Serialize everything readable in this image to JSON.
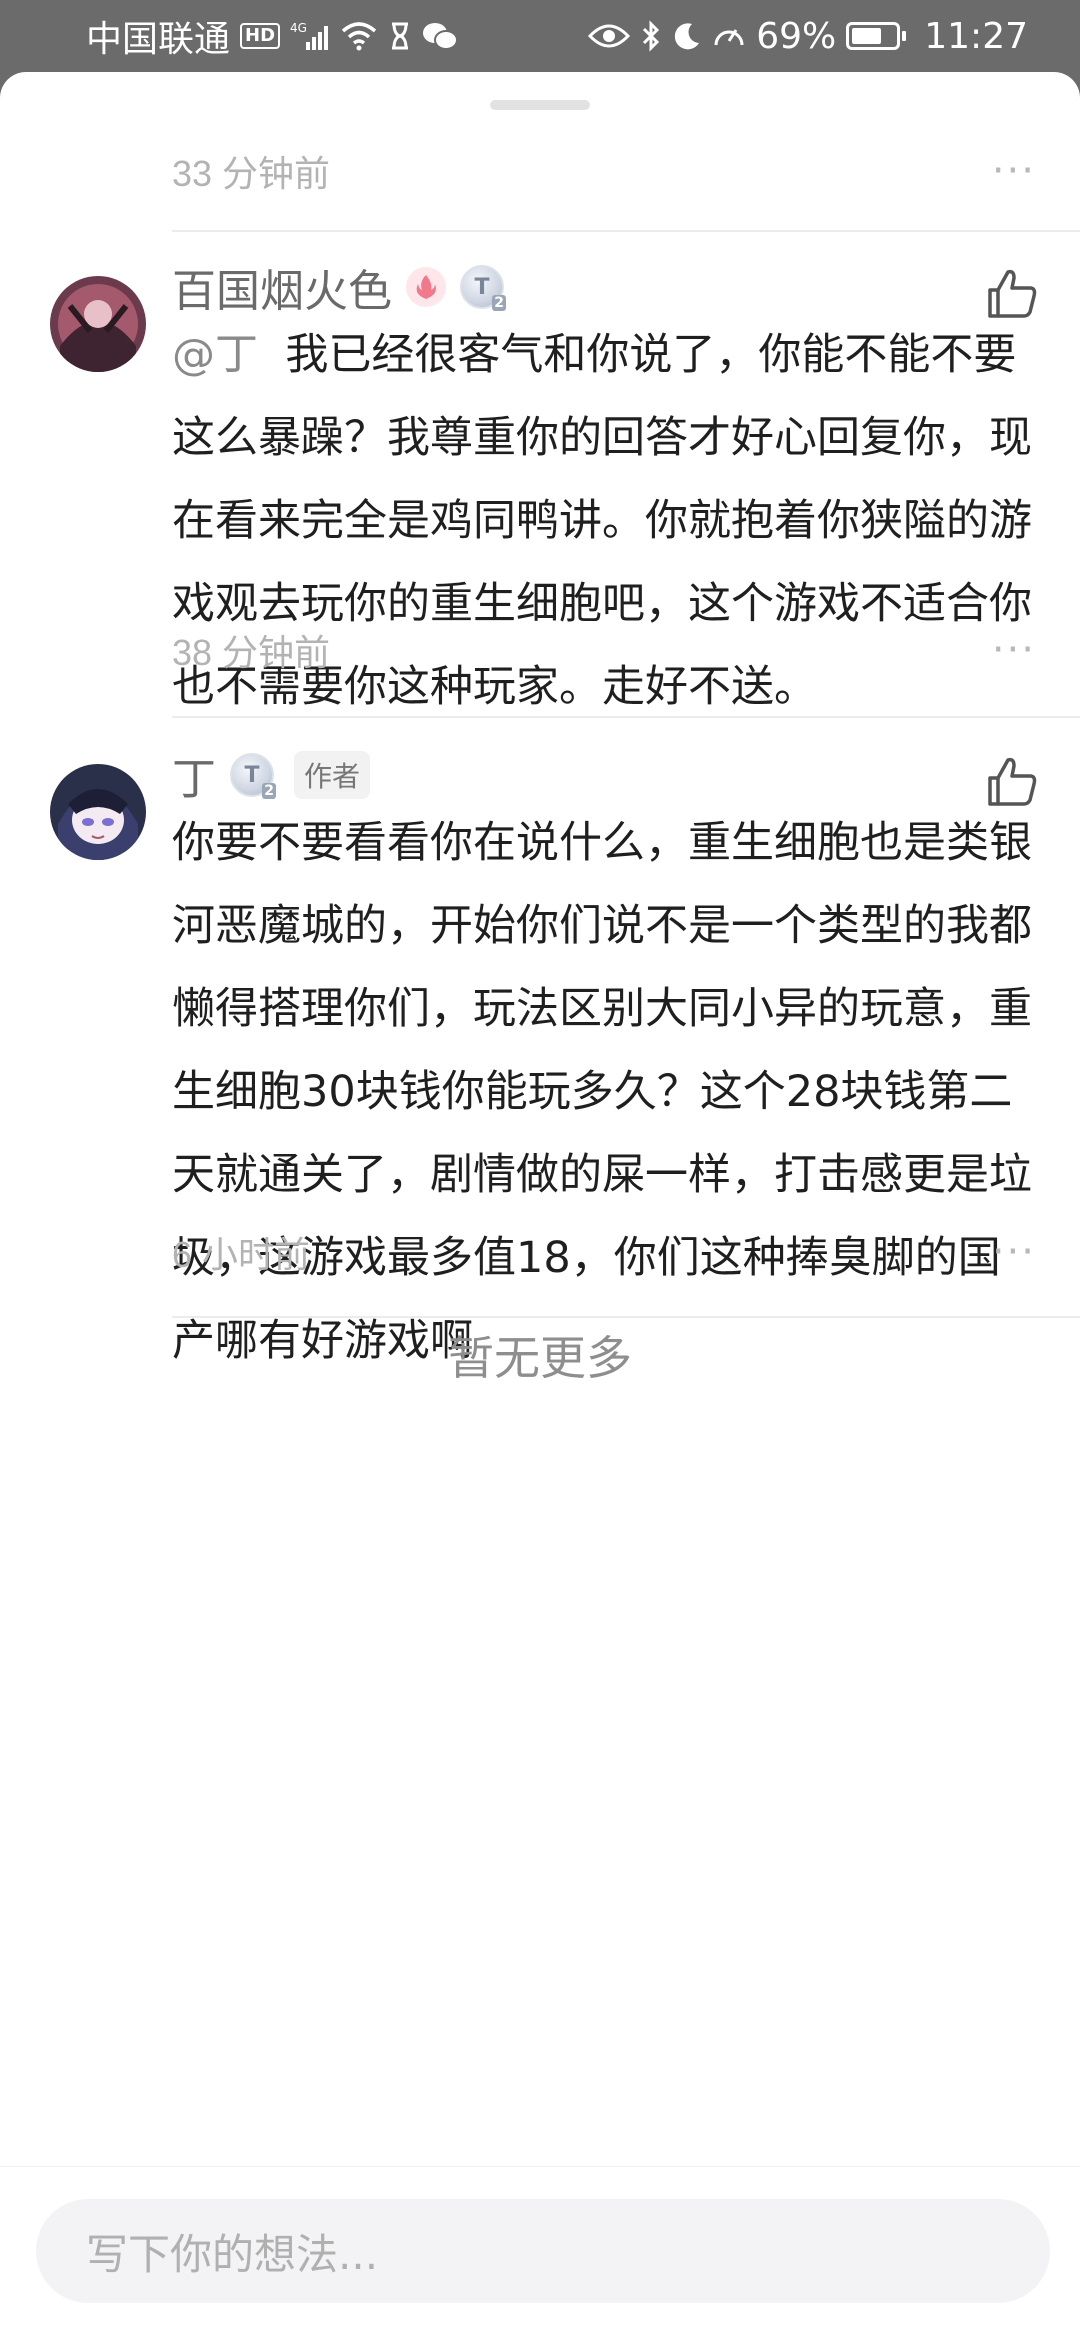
{
  "status_bar": {
    "carrier": "中国联通",
    "hd": "HD",
    "network": "4G",
    "battery": "69%",
    "time": "11:27"
  },
  "top_comment": {
    "time": "33 分钟前",
    "more": "···"
  },
  "comments": [
    {
      "name": "百国烟火色",
      "badges": [
        "flame-badge",
        "T2-level-badge"
      ],
      "mention": "@丁",
      "text": "  我已经很客气和你说了，你能不能不要这么暴躁？我尊重你的回答才好心回复你，现在看来完全是鸡同鸭讲。你就抱着你狭隘的游戏观去玩你的重生细胞吧，这个游戏不适合你也不需要你这种玩家。走好不送。",
      "time": "38 分钟前",
      "more": "···"
    },
    {
      "name": "丁",
      "badges": [
        "T2-level-badge"
      ],
      "author_tag": "作者",
      "text": "你要不要看看你在说什么，重生细胞也是类银河恶魔城的，开始你们说不是一个类型的我都懒得搭理你们，玩法区别大同小异的玩意，重生细胞30块钱你能玩多久？这个28块钱第二天就通关了，剧情做的屎一样，打击感更是垃圾，这游戏最多值18，你们这种捧臭脚的国产哪有好游戏啊",
      "time": "6 小时前",
      "more": "···"
    }
  ],
  "level_badge": {
    "letter": "T",
    "sub": "2"
  },
  "footer": {
    "no_more": "暂无更多"
  },
  "composer": {
    "placeholder": "写下你的想法..."
  },
  "colors": {
    "status_bar_bg": "#6b6b6b",
    "text_primary": "#1f1f1f",
    "text_secondary": "#b3b3b3"
  }
}
